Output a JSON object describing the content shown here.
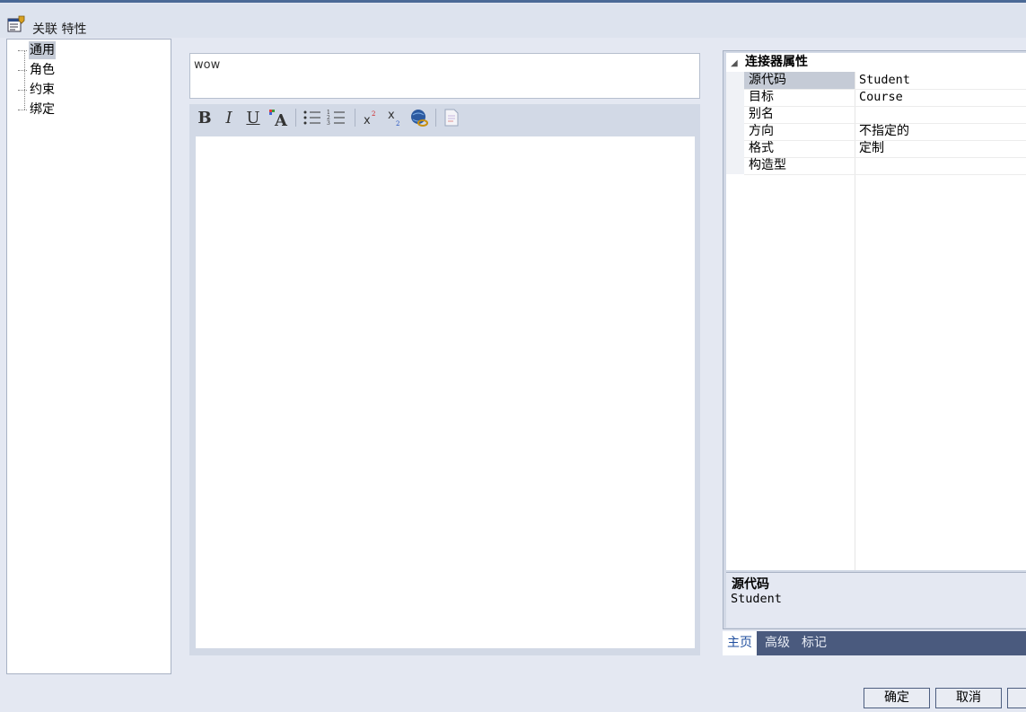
{
  "window": {
    "title": "关联 特性"
  },
  "tree": {
    "items": [
      {
        "label": "通用",
        "selected": true
      },
      {
        "label": "角色",
        "selected": false
      },
      {
        "label": "约束",
        "selected": false
      },
      {
        "label": "绑定",
        "selected": false
      }
    ]
  },
  "notes": {
    "name_value": "wow",
    "toolbar": [
      "bold-icon",
      "italic-icon",
      "underline-icon",
      "font-color-icon",
      "bullet-list-icon",
      "numbered-list-icon",
      "superscript-icon",
      "subscript-icon",
      "hyperlink-icon",
      "linked-document-icon"
    ],
    "body": ""
  },
  "properties": {
    "category": "连接器属性",
    "rows": [
      {
        "key": "源代码",
        "value": "Student",
        "selected": true
      },
      {
        "key": "目标",
        "value": "Course",
        "selected": false
      },
      {
        "key": "别名",
        "value": "",
        "selected": false
      },
      {
        "key": "方向",
        "value": "不指定的",
        "selected": false
      },
      {
        "key": "格式",
        "value": "定制",
        "selected": false
      },
      {
        "key": "构造型",
        "value": "",
        "selected": false
      }
    ],
    "description": {
      "title": "源代码",
      "text": "Student"
    },
    "tabs": [
      {
        "label": "主页",
        "active": true
      },
      {
        "label": "高级",
        "active": false
      },
      {
        "label": "标记",
        "active": false
      }
    ]
  },
  "buttons": {
    "ok": "确定",
    "cancel": "取消"
  },
  "colors": {
    "accent": "#4a5a7e",
    "selection": "#c5cbd6",
    "background": "#e4e8f2"
  }
}
